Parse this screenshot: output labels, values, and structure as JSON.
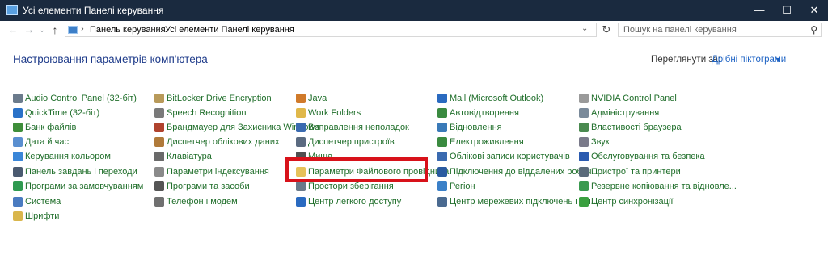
{
  "window": {
    "title": "Усі елементи Панелі керування",
    "minimize": "—",
    "maximize": "☐",
    "close": "✕"
  },
  "address": {
    "crumbs": [
      "Панель керування",
      "Усі елементи Панелі керування"
    ],
    "separator": "›",
    "search_placeholder": "Пошук на панелі керування"
  },
  "header": {
    "title": "Настроювання параметрів комп'ютера",
    "view_by_label": "Переглянути за:",
    "view_by_value": "Дрібні піктограми"
  },
  "columns": [
    [
      {
        "label": "Audio Control Panel (32-біт)",
        "icon": "speaker-icon",
        "color": "#6b7b8c"
      },
      {
        "label": "QuickTime (32-біт)",
        "icon": "quicktime-icon",
        "color": "#2a72c8"
      },
      {
        "label": "Банк файлів",
        "icon": "file-history-icon",
        "color": "#3e8e3a"
      },
      {
        "label": "Дата й час",
        "icon": "clock-icon",
        "color": "#5a8fd0"
      },
      {
        "label": "Керування кольором",
        "icon": "color-icon",
        "color": "#3a86d8"
      },
      {
        "label": "Панель завдань і переходи",
        "icon": "taskbar-icon",
        "color": "#4a5a70"
      },
      {
        "label": "Програми за замовчуванням",
        "icon": "default-programs-icon",
        "color": "#2f9a50"
      },
      {
        "label": "Система",
        "icon": "system-icon",
        "color": "#4a7bc0"
      },
      {
        "label": "Шрифти",
        "icon": "fonts-icon",
        "color": "#d9b64c"
      }
    ],
    [
      {
        "label": "BitLocker Drive Encryption",
        "icon": "bitlocker-icon",
        "color": "#b89a5a"
      },
      {
        "label": "Speech Recognition",
        "icon": "microphone-icon",
        "color": "#7a7a7a"
      },
      {
        "label": "Брандмауер для Захисника Windows",
        "icon": "firewall-icon",
        "color": "#b0432e"
      },
      {
        "label": "Диспетчер облікових даних",
        "icon": "credentials-icon",
        "color": "#b07a3a"
      },
      {
        "label": "Клавіатура",
        "icon": "keyboard-icon",
        "color": "#6a6a6a"
      },
      {
        "label": "Параметри індексування",
        "icon": "indexing-icon",
        "color": "#8a8a8a"
      },
      {
        "label": "Програми та засоби",
        "icon": "programs-icon",
        "color": "#555555"
      },
      {
        "label": "Телефон і модем",
        "icon": "phone-icon",
        "color": "#707070"
      }
    ],
    [
      {
        "label": "Java",
        "icon": "java-icon",
        "color": "#d07a2a"
      },
      {
        "label": "Work Folders",
        "icon": "work-folders-icon",
        "color": "#e0b84a"
      },
      {
        "label": "Виправлення неполадок",
        "icon": "troubleshoot-icon",
        "color": "#3a6ab0"
      },
      {
        "label": "Диспетчер пристроїв",
        "icon": "device-manager-icon",
        "color": "#5a6a80"
      },
      {
        "label": "Миша",
        "icon": "mouse-icon",
        "color": "#505050"
      },
      {
        "label": "Параметри Файлового провідника",
        "icon": "folder-options-icon",
        "color": "#e6c25a"
      },
      {
        "label": "Простори зберігання",
        "icon": "storage-spaces-icon",
        "color": "#6a7a8a"
      },
      {
        "label": "Центр легкого доступу",
        "icon": "ease-of-access-icon",
        "color": "#2a6ac0"
      }
    ],
    [
      {
        "label": "Mail (Microsoft Outlook)",
        "icon": "mail-icon",
        "color": "#2a6ac0"
      },
      {
        "label": "Автовідтворення",
        "icon": "autoplay-icon",
        "color": "#3a8a40"
      },
      {
        "label": "Відновлення",
        "icon": "recovery-icon",
        "color": "#3a7ab8"
      },
      {
        "label": "Електроживлення",
        "icon": "power-icon",
        "color": "#3a8a40"
      },
      {
        "label": "Облікові записи користувачів",
        "icon": "user-accounts-icon",
        "color": "#3a6ab0"
      },
      {
        "label": "Підключення до віддалених робоч...",
        "icon": "remote-desktop-icon",
        "color": "#2a5aa0"
      },
      {
        "label": "Регіон",
        "icon": "region-icon",
        "color": "#3a80c8"
      },
      {
        "label": "Центр мережевих підключень і спі...",
        "icon": "network-icon",
        "color": "#4a6a90"
      }
    ],
    [
      {
        "label": "NVIDIA Control Panel",
        "icon": "nvidia-icon",
        "color": "#9a9a9a"
      },
      {
        "label": "Адміністрування",
        "icon": "admin-tools-icon",
        "color": "#7a8a9a"
      },
      {
        "label": "Властивості браузера",
        "icon": "internet-options-icon",
        "color": "#4a8a50"
      },
      {
        "label": "Звук",
        "icon": "sound-icon",
        "color": "#7a7a8a"
      },
      {
        "label": "Обслуговування та безпека",
        "icon": "flag-icon",
        "color": "#2a5ab0"
      },
      {
        "label": "Пристрої та принтери",
        "icon": "printer-icon",
        "color": "#5a6a7a"
      },
      {
        "label": "Резервне копіювання та відновле...",
        "icon": "backup-icon",
        "color": "#3a9a50"
      },
      {
        "label": "Центр синхронізації",
        "icon": "sync-icon",
        "color": "#3aa040"
      }
    ]
  ]
}
